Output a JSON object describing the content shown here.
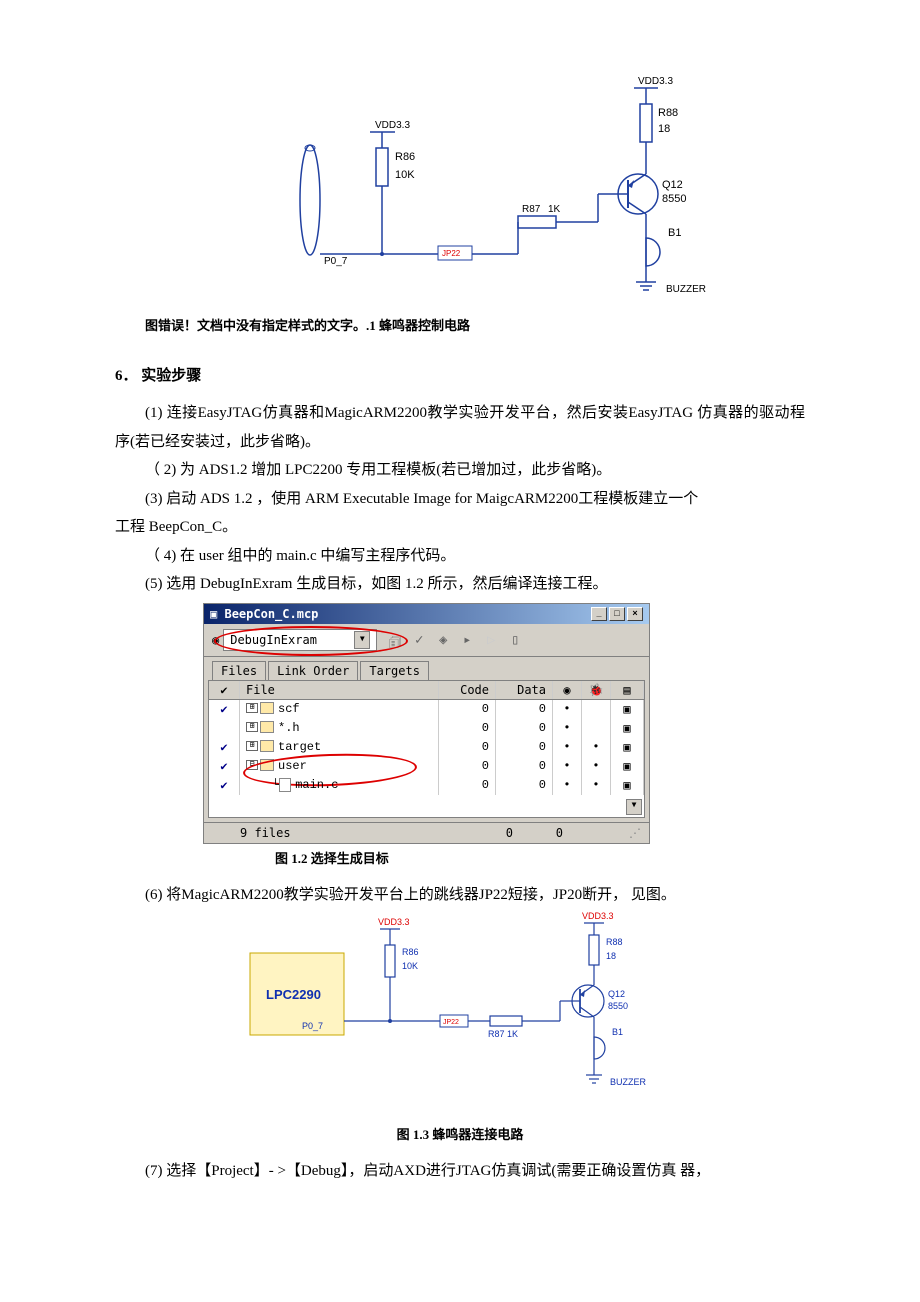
{
  "circuit1": {
    "vdd33_top": "VDD3.3",
    "r88": "R88",
    "r88_val": "18",
    "vdd33_left": "VDD3.3",
    "r86": "R86",
    "r86_val": "10K",
    "p07": "P0_7",
    "jp22": "JP22",
    "r87": "R87",
    "r87_val": "1K",
    "q12": "Q12",
    "q12_val": "8550",
    "b1": "B1",
    "buzzer": "BUZZER",
    "caption": "图错误！文档中没有指定样式的文字。.1 蜂鸣器控制电路"
  },
  "section6": "6．      实验步骤",
  "steps": {
    "s1": "(1) 连接EasyJTAG仿真器和MagicARM2200教学实验开发平台，然后安装EasyJTAG 仿真器的驱动程序(若已经安装过，此步省略)。",
    "s2": "（ 2) 为  ADS1.2 增加  LPC2200 专用工程模板(若已增加过，此步省略)。",
    "s3": "(3) 启动  ADS 1.2 ，使用  ARM Executable Image for MaigcARM2200工程模板建立一个",
    "s3b": "工程  BeepCon_C。",
    "s4": "（ 4) 在  user 组中的  main.c 中编写主程序代码。",
    "s5": "(5) 选用  DebugInExram 生成目标，如图  1.2 所示，然后编译连接工程。",
    "s6": "(6) 将MagicARM2200教学实验开发平台上的跳线器JP22短接，JP20断开， 见图。",
    "s7": "(7) 选择【Project】- >【Debug】，启动AXD进行JTAG仿真调试(需要正确设置仿真  器，"
  },
  "ide": {
    "title": "BeepCon_C.mcp",
    "titleIcon": "▣",
    "dropdown": "DebugInExram",
    "tabs": {
      "files": "Files",
      "link": "Link Order",
      "targets": "Targets"
    },
    "headers": {
      "file": "File",
      "code": "Code",
      "data": "Data"
    },
    "rows": [
      {
        "check": "✔",
        "tree": "⊞",
        "icon": "folder",
        "name": "scf",
        "code": "0",
        "data": "0",
        "b1": "•",
        "b2": "",
        "end": "▣"
      },
      {
        "check": "",
        "tree": "⊞",
        "icon": "folder",
        "name": "*.h",
        "code": "0",
        "data": "0",
        "b1": "•",
        "b2": "",
        "end": "▣"
      },
      {
        "check": "✔",
        "tree": "⊞",
        "icon": "folder",
        "name": "target",
        "code": "0",
        "data": "0",
        "b1": "•",
        "b2": "•",
        "end": "▣"
      },
      {
        "check": "✔",
        "tree": "⊟",
        "icon": "folder",
        "name": "user",
        "code": "0",
        "data": "0",
        "b1": "•",
        "b2": "•",
        "end": "▣"
      },
      {
        "check": "✔",
        "tree": "",
        "icon": "file",
        "name": "main.c",
        "indent": 1,
        "code": "0",
        "data": "0",
        "b1": "•",
        "b2": "•",
        "end": "▣"
      }
    ],
    "footer": {
      "files": "9 files",
      "code": "0",
      "data": "0"
    },
    "caption": "图  1.2 选择生成目标"
  },
  "circuit2": {
    "lpc": "LPC2290",
    "p07": "P0_7",
    "vdd33_l": "VDD3.3",
    "r86": "R86",
    "r86_val": "10K",
    "jp22": "JP22",
    "r87": "R87  1K",
    "vdd33_r": "VDD3.3",
    "r88": "R88",
    "r88_val": "18",
    "q12": "Q12",
    "q12_val": "8550",
    "b1": "B1",
    "buzzer": "BUZZER",
    "caption": "图  1.3 蜂鸣器连接电路"
  }
}
